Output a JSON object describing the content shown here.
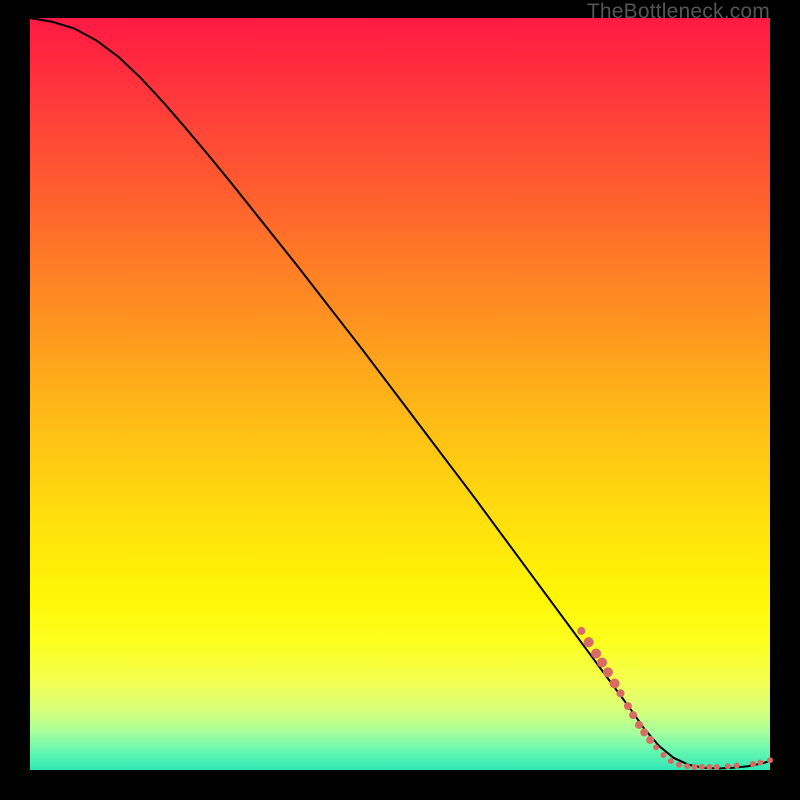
{
  "watermark": "TheBottleneck.com",
  "colors": {
    "curve": "#000000",
    "dot": "#d86b62",
    "frame": "#000000"
  },
  "chart_data": {
    "type": "line",
    "title": "",
    "xlabel": "",
    "ylabel": "",
    "xlim": [
      0,
      100
    ],
    "ylim": [
      0,
      100
    ],
    "series": [
      {
        "name": "curve",
        "x": [
          0,
          3,
          6,
          9,
          12,
          15,
          18,
          21,
          24,
          27,
          30,
          33,
          36,
          39,
          42,
          45,
          48,
          51,
          54,
          57,
          60,
          63,
          66,
          69,
          72,
          75,
          78,
          81,
          83,
          85,
          87,
          89,
          91,
          93,
          95,
          97,
          99,
          100
        ],
        "y": [
          100,
          99.5,
          98.6,
          97.0,
          94.8,
          92.0,
          88.8,
          85.4,
          81.9,
          78.3,
          74.6,
          70.9,
          67.2,
          63.4,
          59.6,
          55.8,
          51.9,
          48.0,
          44.1,
          40.2,
          36.3,
          32.3,
          28.3,
          24.3,
          20.3,
          16.3,
          12.3,
          8.3,
          5.5,
          3.2,
          1.6,
          0.7,
          0.3,
          0.2,
          0.3,
          0.5,
          0.9,
          1.2
        ]
      }
    ],
    "scatter": {
      "name": "dots",
      "points": [
        {
          "x": 74.5,
          "y": 18.5,
          "r": 4
        },
        {
          "x": 75.5,
          "y": 17.0,
          "r": 5
        },
        {
          "x": 76.5,
          "y": 15.5,
          "r": 5
        },
        {
          "x": 77.3,
          "y": 14.3,
          "r": 5
        },
        {
          "x": 78.1,
          "y": 13.0,
          "r": 5
        },
        {
          "x": 79.0,
          "y": 11.5,
          "r": 5
        },
        {
          "x": 79.8,
          "y": 10.2,
          "r": 4
        },
        {
          "x": 80.8,
          "y": 8.5,
          "r": 4
        },
        {
          "x": 81.5,
          "y": 7.3,
          "r": 4
        },
        {
          "x": 82.3,
          "y": 6.0,
          "r": 4
        },
        {
          "x": 83.0,
          "y": 5.0,
          "r": 4
        },
        {
          "x": 83.8,
          "y": 4.0,
          "r": 4
        },
        {
          "x": 84.6,
          "y": 3.0,
          "r": 3
        },
        {
          "x": 85.6,
          "y": 2.0,
          "r": 3
        },
        {
          "x": 86.6,
          "y": 1.2,
          "r": 3
        },
        {
          "x": 87.7,
          "y": 0.7,
          "r": 3
        },
        {
          "x": 88.8,
          "y": 0.5,
          "r": 3
        },
        {
          "x": 89.8,
          "y": 0.4,
          "r": 3
        },
        {
          "x": 90.8,
          "y": 0.4,
          "r": 3
        },
        {
          "x": 91.8,
          "y": 0.4,
          "r": 3
        },
        {
          "x": 92.8,
          "y": 0.4,
          "r": 3
        },
        {
          "x": 94.3,
          "y": 0.5,
          "r": 3
        },
        {
          "x": 95.5,
          "y": 0.6,
          "r": 3
        },
        {
          "x": 97.7,
          "y": 0.8,
          "r": 3
        },
        {
          "x": 98.7,
          "y": 1.0,
          "r": 3
        },
        {
          "x": 100.0,
          "y": 1.3,
          "r": 3
        }
      ]
    }
  }
}
